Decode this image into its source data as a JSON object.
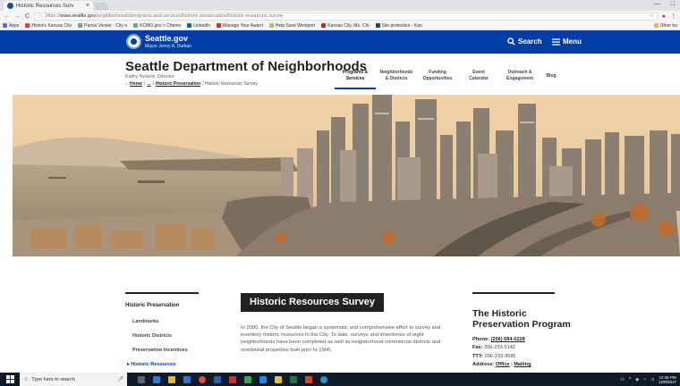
{
  "browser": {
    "tab_title": "Historic Resources Surv",
    "tab_close": "×",
    "window_controls": [
      "—",
      "□"
    ],
    "url_scheme": "https://",
    "url_host": "www.seattle.gov",
    "url_path": "/neighborhoods/programs-and-services/historic-preservation/historic-resources-survey",
    "bookmarks": [
      "Apps",
      "Historic Kansas City",
      "Parcel Viewer - City o",
      "KCMO.gov » Chemo",
      "LinkedIn",
      "Manage Your Award",
      "Help Save Westport",
      "Kansas City, Mo. Chi",
      "Site protection - Kan"
    ],
    "other_bookmarks": "Other bo"
  },
  "seattle_bar": {
    "site_name": "Seattle.gov",
    "mayor": "Mayor Jenny A. Durkan",
    "search_label": "Search",
    "menu_label": "Menu"
  },
  "department": {
    "title": "Seattle Department of Neighborhoods",
    "director": "Kathy Nyland, Director",
    "breadcrumb_home": "Home",
    "breadcrumb_sep1": "/",
    "breadcrumb_ellipsis": "...",
    "breadcrumb_sep2": "/",
    "breadcrumb_section": "Historic Preservation",
    "breadcrumb_current": "/ Historic Resources Survey"
  },
  "nav": [
    {
      "line1": "Programs &",
      "line2": "Services"
    },
    {
      "line1": "Neighborhoods",
      "line2": "& Districts"
    },
    {
      "line1": "Funding",
      "line2": "Opportunities"
    },
    {
      "line1": "Event",
      "line2": "Calendar"
    },
    {
      "line1": "Outreach &",
      "line2": "Engagement"
    },
    {
      "line1": "Blog",
      "line2": ""
    }
  ],
  "sidebar": {
    "heading": "Historic Preservation",
    "items": [
      "Landmarks",
      "Historic Districts",
      "Preservation Incentives",
      "Historic Resources"
    ]
  },
  "article": {
    "title": "Historic Resources Survey",
    "body": "In 2000, the City of Seattle began a systematic and comprehensive effort to survey and inventory historic resources in the City. To date, surveys and inventories of eight neighborhoods have been completed as well as neighborhood commercial districts and residential properties built prior to 1906."
  },
  "program": {
    "title_line1": "The Historic",
    "title_line2": "Preservation Program",
    "phone_label": "Phone:",
    "phone": "(206) 684-0228",
    "fax_label": "Fax:",
    "fax": "206-233-5142",
    "tty_label": "TTY:",
    "tty": "206-233-9595",
    "address_label": "Address:",
    "address_links": [
      "Office",
      "Mailing"
    ]
  },
  "taskbar": {
    "search_placeholder": "Type here to search",
    "time": "12:36 PM",
    "date": "12/8/2017"
  },
  "colors": {
    "brand_blue": "#003da5",
    "taskbar": "#101b29"
  }
}
